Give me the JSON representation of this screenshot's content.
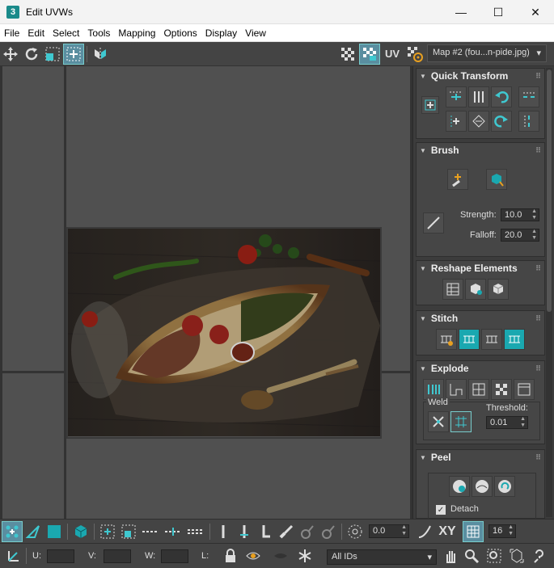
{
  "window": {
    "app_icon_text": "3",
    "title": "Edit UVWs",
    "minimize": "—",
    "maximize": "☐",
    "close": "✕"
  },
  "menu": [
    "File",
    "Edit",
    "Select",
    "Tools",
    "Mapping",
    "Options",
    "Display",
    "View"
  ],
  "toolbar": {
    "uv_label": "UV",
    "map_select": "Map #2 (fou...n-pide.jpg)"
  },
  "panel": {
    "quick_transform": {
      "title": "Quick Transform"
    },
    "brush": {
      "title": "Brush",
      "strength_label": "Strength:",
      "strength_value": "10.0",
      "falloff_label": "Falloff:",
      "falloff_value": "20.0"
    },
    "reshape": {
      "title": "Reshape Elements"
    },
    "stitch": {
      "title": "Stitch"
    },
    "explode": {
      "title": "Explode",
      "weld_label": "Weld",
      "threshold_label": "Threshold:",
      "threshold_value": "0.01"
    },
    "peel": {
      "title": "Peel",
      "detach_label": "Detach",
      "detach_checked": true
    }
  },
  "bottom": {
    "rotate_value": "0.0",
    "xy_label": "XY",
    "snap_value": "16",
    "u_label": "U:",
    "v_label": "V:",
    "w_label": "W:",
    "l_label": "L:",
    "ids_select": "All IDs"
  },
  "colors": {
    "accent": "#1aa8b0",
    "background": "#444444",
    "viewport": "#505050"
  }
}
